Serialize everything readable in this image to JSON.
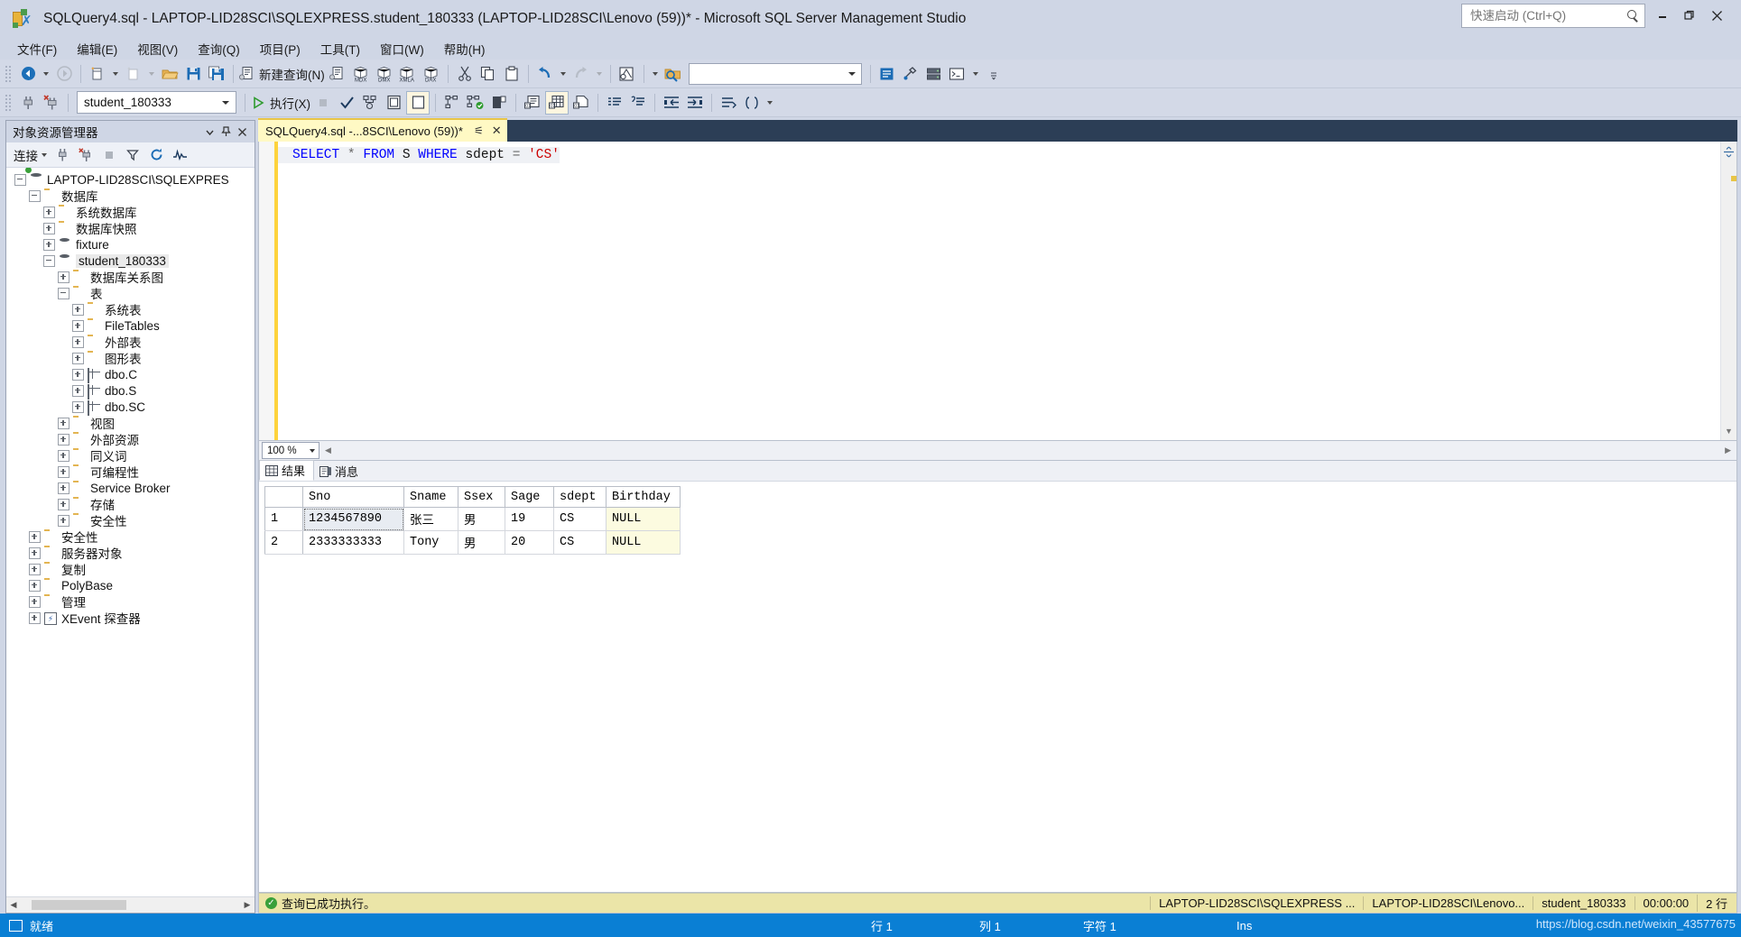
{
  "window": {
    "title": "SQLQuery4.sql - LAPTOP-LID28SCI\\SQLEXPRESS.student_180333 (LAPTOP-LID28SCI\\Lenovo (59))* - Microsoft SQL Server Management Studio",
    "quick_launch_placeholder": "快速启动 (Ctrl+Q)",
    "minimize": "—",
    "restore": "❐",
    "close": "✕"
  },
  "menu": {
    "items": [
      {
        "label": "文件(F)"
      },
      {
        "label": "编辑(E)"
      },
      {
        "label": "视图(V)"
      },
      {
        "label": "查询(Q)"
      },
      {
        "label": "项目(P)"
      },
      {
        "label": "工具(T)"
      },
      {
        "label": "窗口(W)"
      },
      {
        "label": "帮助(H)"
      }
    ]
  },
  "toolbar_main": {
    "new_query_label": "新建查询(N)",
    "mdx_label": "MDX",
    "dmx_label": "DMX",
    "xmla_label": "XMLA",
    "dax_label": "DAX"
  },
  "toolbar_sql": {
    "database": "student_180333",
    "execute_label": "执行(X)"
  },
  "object_explorer": {
    "title": "对象资源管理器",
    "connect_label": "连接",
    "tree": [
      {
        "label": "LAPTOP-LID28SCI\\SQLEXPRES",
        "indent": 0,
        "icon": "server-icon",
        "state": "expanded"
      },
      {
        "label": "数据库",
        "indent": 1,
        "icon": "folder-icon",
        "state": "expanded"
      },
      {
        "label": "系统数据库",
        "indent": 2,
        "icon": "folder-icon",
        "state": "collapsed"
      },
      {
        "label": "数据库快照",
        "indent": 2,
        "icon": "folder-icon",
        "state": "collapsed"
      },
      {
        "label": "fixture",
        "indent": 2,
        "icon": "database-icon",
        "state": "collapsed"
      },
      {
        "label": "student_180333",
        "indent": 2,
        "icon": "database-icon",
        "state": "expanded",
        "selected": true
      },
      {
        "label": "数据库关系图",
        "indent": 3,
        "icon": "folder-icon",
        "state": "collapsed"
      },
      {
        "label": "表",
        "indent": 3,
        "icon": "folder-icon",
        "state": "expanded"
      },
      {
        "label": "系统表",
        "indent": 4,
        "icon": "folder-icon",
        "state": "collapsed"
      },
      {
        "label": "FileTables",
        "indent": 4,
        "icon": "folder-icon",
        "state": "collapsed"
      },
      {
        "label": "外部表",
        "indent": 4,
        "icon": "folder-icon",
        "state": "collapsed"
      },
      {
        "label": "图形表",
        "indent": 4,
        "icon": "folder-icon",
        "state": "collapsed"
      },
      {
        "label": "dbo.C",
        "indent": 4,
        "icon": "table-icon",
        "state": "collapsed"
      },
      {
        "label": "dbo.S",
        "indent": 4,
        "icon": "table-icon",
        "state": "collapsed"
      },
      {
        "label": "dbo.SC",
        "indent": 4,
        "icon": "table-icon",
        "state": "collapsed"
      },
      {
        "label": "视图",
        "indent": 3,
        "icon": "folder-icon",
        "state": "collapsed"
      },
      {
        "label": "外部资源",
        "indent": 3,
        "icon": "folder-icon",
        "state": "collapsed"
      },
      {
        "label": "同义词",
        "indent": 3,
        "icon": "folder-icon",
        "state": "collapsed"
      },
      {
        "label": "可编程性",
        "indent": 3,
        "icon": "folder-icon",
        "state": "collapsed"
      },
      {
        "label": "Service Broker",
        "indent": 3,
        "icon": "folder-icon",
        "state": "collapsed"
      },
      {
        "label": "存储",
        "indent": 3,
        "icon": "folder-icon",
        "state": "collapsed"
      },
      {
        "label": "安全性",
        "indent": 3,
        "icon": "folder-icon",
        "state": "collapsed"
      },
      {
        "label": "安全性",
        "indent": 1,
        "icon": "folder-icon",
        "state": "collapsed"
      },
      {
        "label": "服务器对象",
        "indent": 1,
        "icon": "folder-icon",
        "state": "collapsed"
      },
      {
        "label": "复制",
        "indent": 1,
        "icon": "folder-icon",
        "state": "collapsed"
      },
      {
        "label": "PolyBase",
        "indent": 1,
        "icon": "folder-icon",
        "state": "collapsed"
      },
      {
        "label": "管理",
        "indent": 1,
        "icon": "folder-icon",
        "state": "collapsed"
      },
      {
        "label": "XEvent 探查器",
        "indent": 1,
        "icon": "xevent-icon",
        "state": "collapsed"
      }
    ]
  },
  "editor": {
    "tab_title": "SQLQuery4.sql -...8SCI\\Lenovo (59))*",
    "code_tokens": [
      {
        "text": "SELECT",
        "type": "kw"
      },
      {
        "text": " ",
        "type": "ws"
      },
      {
        "text": "*",
        "type": "op"
      },
      {
        "text": " ",
        "type": "ws"
      },
      {
        "text": "FROM",
        "type": "kw"
      },
      {
        "text": " ",
        "type": "ws"
      },
      {
        "text": "S",
        "type": "id"
      },
      {
        "text": " ",
        "type": "ws"
      },
      {
        "text": "WHERE",
        "type": "kw"
      },
      {
        "text": " ",
        "type": "ws"
      },
      {
        "text": "sdept",
        "type": "id"
      },
      {
        "text": " ",
        "type": "ws"
      },
      {
        "text": "=",
        "type": "op"
      },
      {
        "text": " ",
        "type": "ws"
      },
      {
        "text": "'CS'",
        "type": "str"
      }
    ],
    "zoom_level": "100 %"
  },
  "results": {
    "tabs": [
      {
        "label": "结果",
        "icon": "grid-icon",
        "active": true
      },
      {
        "label": "消息",
        "icon": "message-icon",
        "active": false
      }
    ],
    "columns": [
      "Sno",
      "Sname",
      "Ssex",
      "Sage",
      "sdept",
      "Birthday"
    ],
    "rows": [
      {
        "num": "1",
        "cells": [
          "1234567890",
          "张三",
          "男",
          "19",
          "CS",
          "NULL"
        ]
      },
      {
        "num": "2",
        "cells": [
          "2333333333",
          "Tony",
          "男",
          "20",
          "CS",
          "NULL"
        ]
      }
    ]
  },
  "query_status": {
    "message": "查询已成功执行。",
    "server": "LAPTOP-LID28SCI\\SQLEXPRESS ...",
    "user": "LAPTOP-LID28SCI\\Lenovo...",
    "database": "student_180333",
    "elapsed": "00:00:00",
    "rowcount": "2 行"
  },
  "statusbar": {
    "ready": "就绪",
    "line": "行 1",
    "column": "列 1",
    "char": "字符 1",
    "insert_mode": "Ins",
    "watermark": "https://blog.csdn.net/weixin_43577675"
  }
}
